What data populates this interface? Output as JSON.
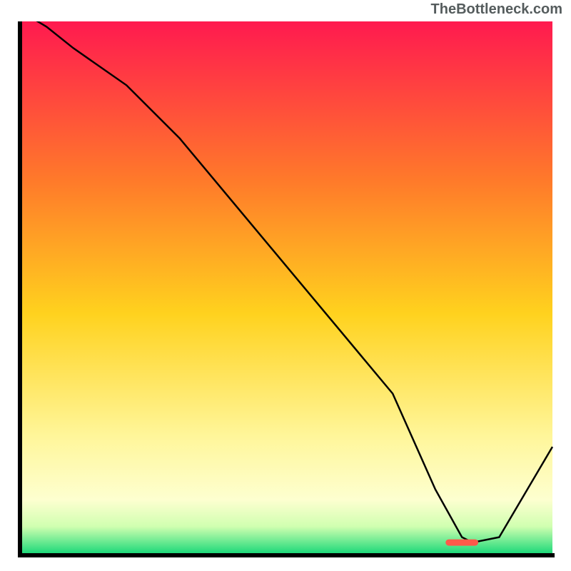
{
  "source_label": "TheBottleneck.com",
  "colors": {
    "gradient_top": "#ff1a4f",
    "gradient_mid1": "#ff7a2a",
    "gradient_mid2": "#ffd21e",
    "gradient_mid3": "#fff69a",
    "gradient_mid4": "#e8ffc0",
    "gradient_bottom": "#1fd97a",
    "line": "#000000",
    "axis": "#000000",
    "marker": "#ff5a4a"
  },
  "chart_data": {
    "type": "line",
    "x": [
      0,
      5,
      10,
      20,
      30,
      40,
      50,
      60,
      70,
      78,
      83,
      85,
      90,
      100
    ],
    "values": [
      102,
      99,
      95,
      88,
      78,
      66,
      54,
      42,
      30,
      12,
      3,
      2,
      3,
      20
    ],
    "title": "",
    "xlabel": "",
    "ylabel": "",
    "xlim": [
      0,
      100
    ],
    "ylim": [
      0,
      100
    ],
    "marker": {
      "x_start": 80,
      "x_end": 86,
      "y": 2
    },
    "grid": false,
    "legend": false
  }
}
